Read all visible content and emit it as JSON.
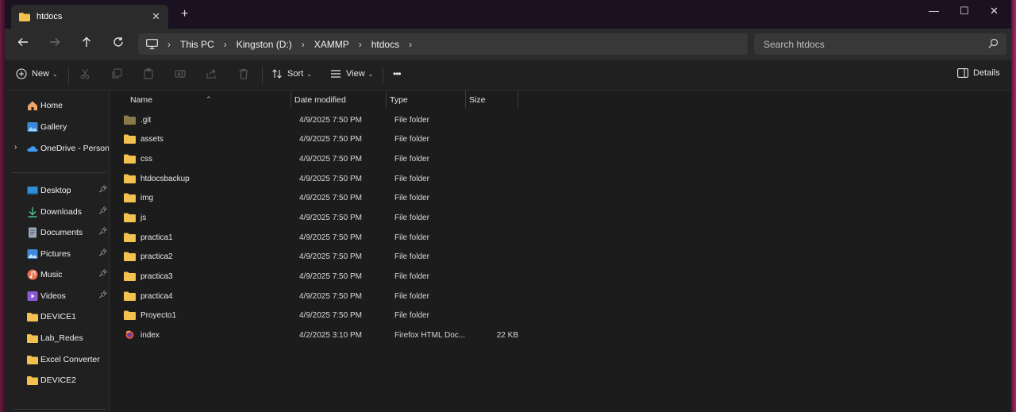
{
  "window": {
    "tab_title": "htdocs",
    "new_tab": "+",
    "minimize": "—",
    "maximize": "☐",
    "close": "✕"
  },
  "nav": {
    "breadcrumbs": [
      "This PC",
      "Kingston (D:)",
      "XAMMP",
      "htdocs"
    ],
    "search_placeholder": "Search htdocs"
  },
  "toolbar": {
    "new_label": "New",
    "sort_label": "Sort",
    "view_label": "View",
    "more_label": "•••",
    "details_label": "Details"
  },
  "sidebar": {
    "items": [
      {
        "label": "Home",
        "icon": "home-icon"
      },
      {
        "label": "Gallery",
        "icon": "gallery-icon"
      },
      {
        "label": "OneDrive - Persona",
        "icon": "onedrive-icon"
      },
      {
        "label": "Desktop",
        "icon": "desktop-icon",
        "pinned": true
      },
      {
        "label": "Downloads",
        "icon": "downloads-icon",
        "pinned": true
      },
      {
        "label": "Documents",
        "icon": "documents-icon",
        "pinned": true
      },
      {
        "label": "Pictures",
        "icon": "pictures-icon",
        "pinned": true
      },
      {
        "label": "Music",
        "icon": "music-icon",
        "pinned": true
      },
      {
        "label": "Videos",
        "icon": "videos-icon",
        "pinned": true
      },
      {
        "label": "DEVICE1",
        "icon": "folder-icon"
      },
      {
        "label": "Lab_Redes",
        "icon": "folder-icon"
      },
      {
        "label": "Excel Converter",
        "icon": "folder-icon"
      },
      {
        "label": "DEVICE2",
        "icon": "folder-icon"
      }
    ]
  },
  "columns": {
    "name": "Name",
    "date": "Date modified",
    "type": "Type",
    "size": "Size"
  },
  "files": [
    {
      "name": ".git",
      "date": "4/9/2025 7:50 PM",
      "type": "File folder",
      "size": ""
    },
    {
      "name": "assets",
      "date": "4/9/2025 7:50 PM",
      "type": "File folder",
      "size": ""
    },
    {
      "name": "css",
      "date": "4/9/2025 7:50 PM",
      "type": "File folder",
      "size": ""
    },
    {
      "name": "htdocsbackup",
      "date": "4/9/2025 7:50 PM",
      "type": "File folder",
      "size": ""
    },
    {
      "name": "img",
      "date": "4/9/2025 7:50 PM",
      "type": "File folder",
      "size": ""
    },
    {
      "name": "js",
      "date": "4/9/2025 7:50 PM",
      "type": "File folder",
      "size": ""
    },
    {
      "name": "practica1",
      "date": "4/9/2025 7:50 PM",
      "type": "File folder",
      "size": ""
    },
    {
      "name": "practica2",
      "date": "4/9/2025 7:50 PM",
      "type": "File folder",
      "size": ""
    },
    {
      "name": "practica3",
      "date": "4/9/2025 7:50 PM",
      "type": "File folder",
      "size": ""
    },
    {
      "name": "practica4",
      "date": "4/9/2025 7:50 PM",
      "type": "File folder",
      "size": ""
    },
    {
      "name": "Proyecto1",
      "date": "4/9/2025 7:50 PM",
      "type": "File folder",
      "size": ""
    },
    {
      "name": "index",
      "date": "4/2/2025 3:10 PM",
      "type": "Firefox HTML Doc...",
      "size": "22 KB"
    }
  ],
  "colors": {
    "folder": "#f2c14e",
    "git_folder": "#8a7a4a",
    "accent": "#4aa3ff"
  }
}
